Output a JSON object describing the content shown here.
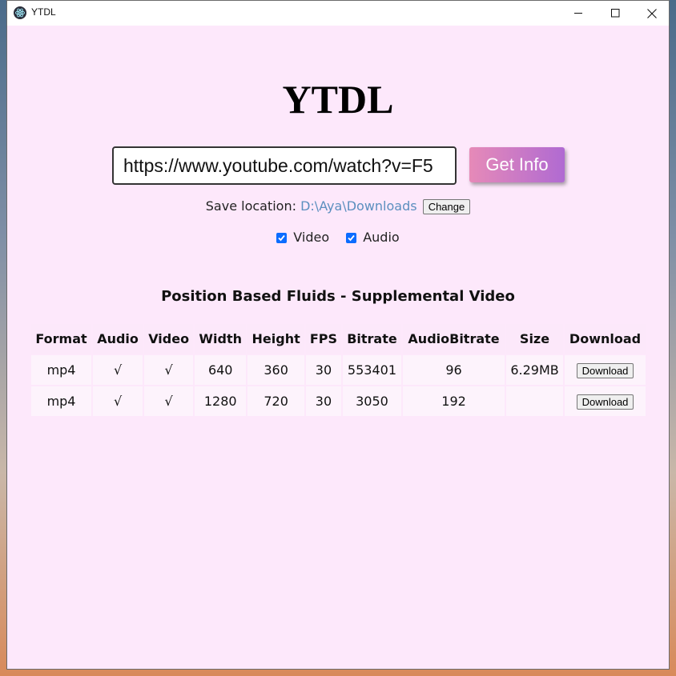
{
  "window": {
    "title": "YTDL"
  },
  "main": {
    "heading": "YTDL",
    "url_value": "https://www.youtube.com/watch?v=F5",
    "get_info_label": "Get Info",
    "save_location_label": "Save location:",
    "save_location_path": "D:\\Aya\\Downloads",
    "change_label": "Change",
    "video_check_label": "Video",
    "audio_check_label": "Audio",
    "video_title": "Position Based Fluids - Supplemental Video"
  },
  "table": {
    "headers": [
      "Format",
      "Audio",
      "Video",
      "Width",
      "Height",
      "FPS",
      "Bitrate",
      "AudioBitrate",
      "Size",
      "Download"
    ],
    "rows": [
      {
        "format": "mp4",
        "audio": "√",
        "video": "√",
        "width": "640",
        "height": "360",
        "fps": "30",
        "bitrate": "553401",
        "audio_bitrate": "96",
        "size": "6.29MB",
        "download_label": "Download"
      },
      {
        "format": "mp4",
        "audio": "√",
        "video": "√",
        "width": "1280",
        "height": "720",
        "fps": "30",
        "bitrate": "3050",
        "audio_bitrate": "192",
        "size": "",
        "download_label": "Download"
      }
    ]
  },
  "colors": {
    "background": "#fde8fb",
    "button_gradient_start": "#e68ab8",
    "button_gradient_end": "#b06ad2",
    "path_link": "#5b8fbf",
    "checkbox": "#0b6cff"
  },
  "icons": {
    "app": "electron-icon",
    "minimize": "minimize-icon",
    "maximize": "maximize-icon",
    "close": "close-icon"
  }
}
